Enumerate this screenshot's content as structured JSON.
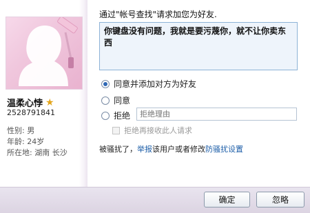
{
  "profile": {
    "nickname": "温柔心悖",
    "qq_number": "2528791841",
    "gender": "性别: 男",
    "age": "年龄: 24岁",
    "location": "所在地: 湖南 长沙"
  },
  "request": {
    "title": "通过\"帐号查找\"请求加您为好友.",
    "message": "你键盘没有问题，我就是要污蔑你，就不让你卖东西"
  },
  "options": {
    "accept_add_label": "同意并添加对方为好友",
    "accept_label": "同意",
    "reject_label": "拒绝",
    "selected": "accept_add",
    "reject_reason_placeholder": "拒绝理由",
    "block_label": "拒绝再接收此人请求"
  },
  "harassment": {
    "prefix": "被骚扰了，",
    "report_link": "举报",
    "middle": "该用户或者修改",
    "settings_link": "防骚扰设置"
  },
  "footer": {
    "confirm_label": "确定",
    "ignore_label": "忽略"
  },
  "icons": {
    "vip_star": "star-icon"
  },
  "colors": {
    "accent": "#2f68b4",
    "link": "#1d5ea8",
    "message_bg": "#eef4fb"
  }
}
